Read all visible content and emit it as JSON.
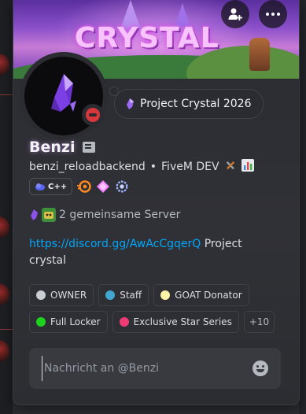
{
  "banner": {
    "title": "CRYSTAL"
  },
  "actions": {
    "add_friend_icon": "add-friend-icon",
    "more_icon": "more-icon"
  },
  "status": {
    "text": "Project Crystal 2026",
    "presence": "do-not-disturb",
    "color": "#da373c"
  },
  "profile": {
    "display_name": "Benzi",
    "username": "benzi_reloadbackend",
    "separator": "•",
    "pronouns": "FiveM DEV",
    "badges": [
      {
        "name": "cpp-badge",
        "label": "C++"
      },
      {
        "name": "nitro-badge"
      },
      {
        "name": "gem-badge"
      },
      {
        "name": "wreath-badge"
      }
    ]
  },
  "mutual": {
    "text": "2 gemeinsame Server"
  },
  "bio": {
    "link": "https://discord.gg/AwAcCgqerQ",
    "text": " Project crystal"
  },
  "roles": [
    {
      "label": "OWNER",
      "color": "#c9cdd4"
    },
    {
      "label": "Staff",
      "color": "#41a6d0"
    },
    {
      "label": "GOAT Donator",
      "color": "#fff3a8"
    },
    {
      "label": "Full Locker",
      "color": "#1ed31e"
    },
    {
      "label": "Exclusive Star Series",
      "color": "#ee3b76"
    }
  ],
  "roles_more": "+10",
  "message": {
    "placeholder": "Nachricht an @Benzi"
  },
  "colors": {
    "link": "#00a8fc",
    "card_bg": "#2b2d31",
    "input_bg": "#383a40"
  }
}
